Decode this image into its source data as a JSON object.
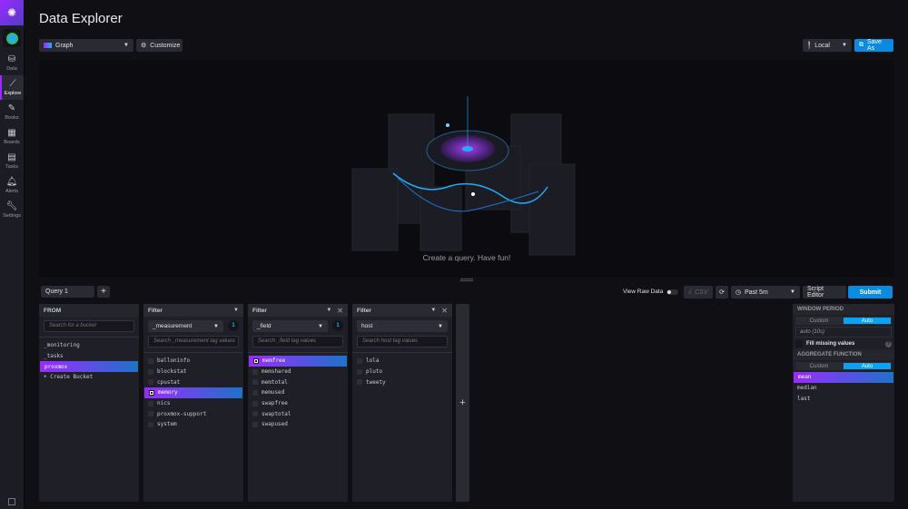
{
  "nav": {
    "items": [
      {
        "label": "Data",
        "icon": "database-icon"
      },
      {
        "label": "Explore",
        "icon": "explore-icon"
      },
      {
        "label": "Books",
        "icon": "notebook-icon"
      },
      {
        "label": "Boards",
        "icon": "dashboard-icon"
      },
      {
        "label": "Tasks",
        "icon": "calendar-icon"
      },
      {
        "label": "Alerts",
        "icon": "bell-icon"
      },
      {
        "label": "Settings",
        "icon": "wrench-icon"
      }
    ]
  },
  "header": {
    "title": "Data Explorer",
    "graph_type": "Graph",
    "customize": "Customize",
    "timezone": "Local",
    "save_as": "Save As"
  },
  "graph": {
    "hint": "Create a query. Have fun!"
  },
  "query": {
    "tab": "Query 1",
    "add": "+",
    "view_raw": "View Raw Data",
    "csv": "CSV",
    "time_range": "Past 5m",
    "script_editor": "Script Editor",
    "submit": "Submit"
  },
  "from": {
    "title": "FROM",
    "placeholder": "Search for a bucket",
    "buckets": [
      "_monitoring",
      "_tasks",
      "proxmox"
    ],
    "create": "+ Create Bucket"
  },
  "filters": [
    {
      "title": "Filter",
      "key": "_measurement",
      "count": "1",
      "placeholder": "Search _measurement tag values",
      "values": [
        "balloninfo",
        "blockstat",
        "cpustat",
        "memory",
        "nics",
        "proxmox-support",
        "system"
      ],
      "selected": "memory"
    },
    {
      "title": "Filter",
      "key": "_field",
      "count": "1",
      "placeholder": "Search _field tag values",
      "values": [
        "memfree",
        "memshared",
        "memtotal",
        "memused",
        "swapfree",
        "swaptotal",
        "swapused"
      ],
      "selected": "memfree"
    },
    {
      "title": "Filter",
      "key": "host",
      "count": "",
      "placeholder": "Search host tag values",
      "values": [
        "lola",
        "pluto",
        "tweety"
      ],
      "selected": ""
    }
  ],
  "aggregate": {
    "window_title": "WINDOW PERIOD",
    "custom": "Custom",
    "auto": "Auto",
    "window_value": "auto (10s)",
    "fill_missing": "Fill missing values",
    "func_title": "AGGREGATE FUNCTION",
    "functions": [
      "mean",
      "median",
      "last"
    ],
    "selected": "mean"
  },
  "add_column": "+"
}
